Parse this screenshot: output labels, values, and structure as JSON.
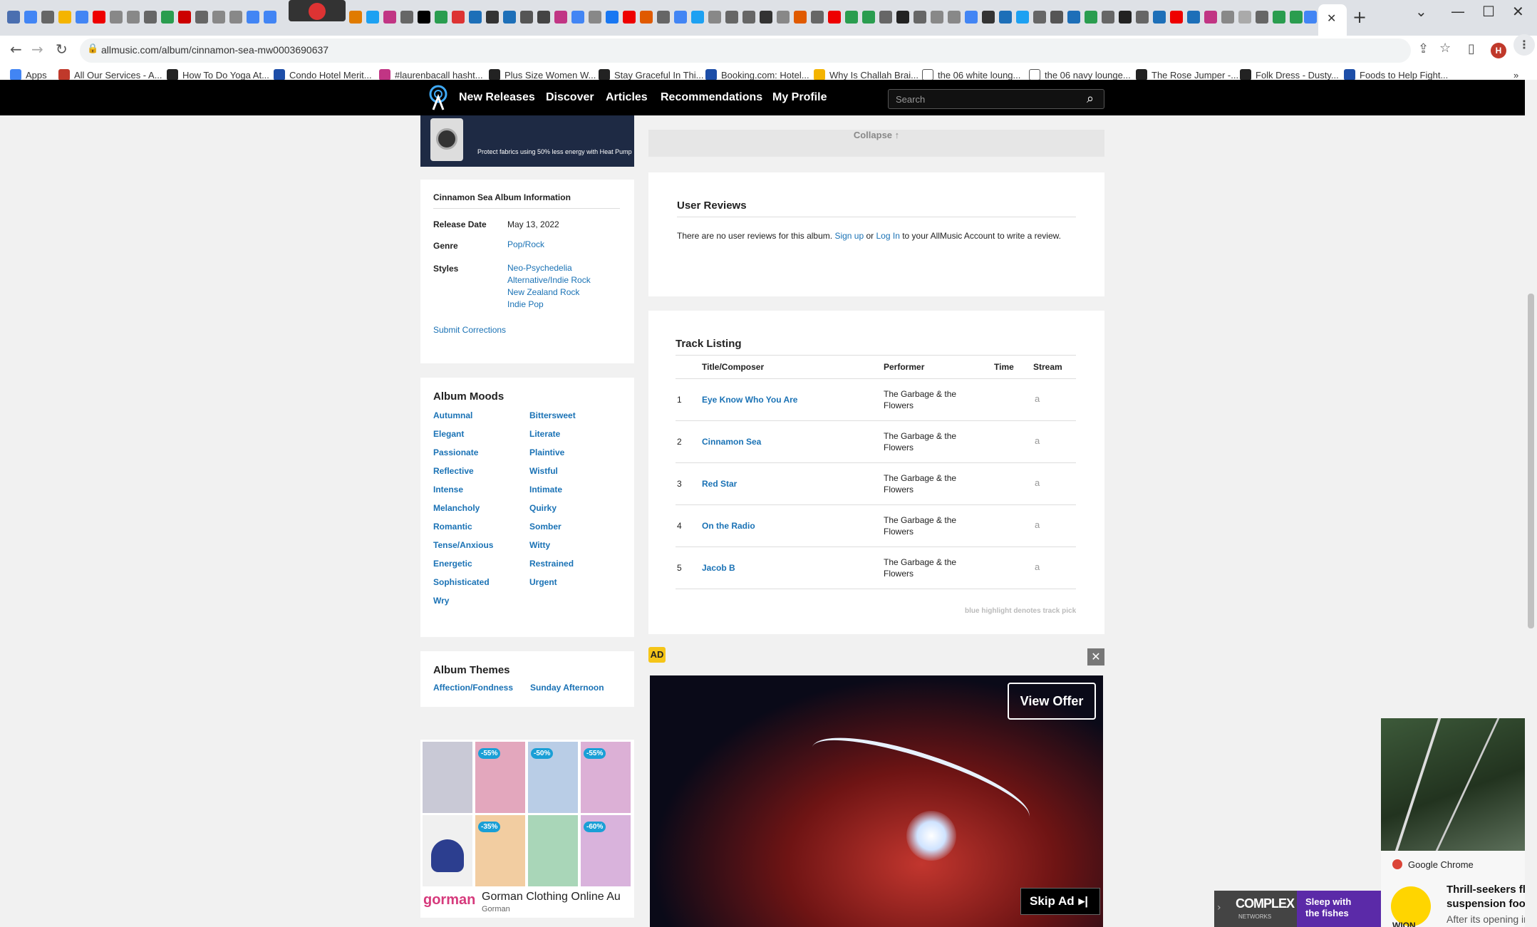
{
  "browser": {
    "url": "allmusic.com/album/cinnamon-sea-mw0003690637",
    "avatar_letter": "H",
    "bookmarks": [
      "Apps",
      "All Our Services - A...",
      "How To Do Yoga At...",
      "Condo Hotel Merit...",
      "#laurenbacall hasht...",
      "Plus Size Women W...",
      "Stay Graceful In Thi...",
      "Booking.com: Hotel...",
      "Why Is Challah Brai...",
      "the 06 white loung...",
      "the 06 navy lounge...",
      "The Rose Jumper -...",
      "Folk Dress - Dusty...",
      "Foods to Help Fight..."
    ]
  },
  "nav": {
    "links": [
      "New Releases",
      "Discover",
      "Articles",
      "Recommendations",
      "My Profile"
    ],
    "search_placeholder": "Search"
  },
  "top_ad": {
    "text": "Protect fabrics using 50% less energy with Heat Pump"
  },
  "collapse_label": "Collapse ↑",
  "album_info": {
    "heading": "Cinnamon Sea Album Information",
    "release_label": "Release Date",
    "release_value": "May 13, 2022",
    "genre_label": "Genre",
    "genre_value": "Pop/Rock",
    "styles_label": "Styles",
    "styles": [
      "Neo-Psychedelia",
      "Alternative/Indie Rock",
      "New Zealand Rock",
      "Indie Pop"
    ],
    "submit": "Submit Corrections"
  },
  "moods": {
    "heading": "Album Moods",
    "items": [
      "Autumnal",
      "Bittersweet",
      "Elegant",
      "Literate",
      "Passionate",
      "Plaintive",
      "Reflective",
      "Wistful",
      "Intense",
      "Intimate",
      "Melancholy",
      "Quirky",
      "Romantic",
      "Somber",
      "Tense/Anxious",
      "Witty",
      "Energetic",
      "Restrained",
      "Sophisticated",
      "Urgent",
      "Wry"
    ]
  },
  "themes": {
    "heading": "Album Themes",
    "items": [
      "Affection/Fondness",
      "Sunday Afternoon"
    ]
  },
  "user_reviews": {
    "heading": "User Reviews",
    "text_before": "There are no user reviews for this album.",
    "signup": "Sign up",
    "or": "or",
    "login": "Log In",
    "text_after": "to your AllMusic Account to write a review."
  },
  "tracks": {
    "heading": "Track Listing",
    "columns": [
      "Title/Composer",
      "Performer",
      "Time",
      "Stream"
    ],
    "rows": [
      {
        "num": "1",
        "title": "Eye Know Who You Are",
        "performer_1": "The Garbage & the",
        "performer_2": "Flowers"
      },
      {
        "num": "2",
        "title": "Cinnamon Sea",
        "performer_1": "The Garbage & the",
        "performer_2": "Flowers"
      },
      {
        "num": "3",
        "title": "Red Star",
        "performer_1": "The Garbage & the",
        "performer_2": "Flowers"
      },
      {
        "num": "4",
        "title": "On the Radio",
        "performer_1": "The Garbage & the",
        "performer_2": "Flowers"
      },
      {
        "num": "5",
        "title": "Jacob B",
        "performer_1": "The Garbage & the",
        "performer_2": "Flowers"
      }
    ],
    "stream_glyph": "a",
    "note": "blue highlight denotes track pick"
  },
  "video_ad": {
    "badge": "AD",
    "view_offer": "View Offer",
    "skip": "Skip Ad",
    "close": "✕"
  },
  "gorman_ad": {
    "logo": "gorman",
    "title": "Gorman Clothing Online Au",
    "sub": "Gorman",
    "badges": [
      "-55%",
      "-50%",
      "-55%",
      "-35%",
      "-60%"
    ]
  },
  "complex_ad": {
    "logo": "COMPLEX",
    "logo_sub": "NETWORKS",
    "text_1": "Sleep with",
    "text_2": "the fishes"
  },
  "notification": {
    "app": "Google Chrome",
    "source": "WION",
    "title_1": "Thrill-seekers flock",
    "title_2": "suspension footbri",
    "body": "After its opening in"
  },
  "colors": {
    "link": "#1a72b5",
    "navbar": "#000000",
    "ad_badge": "#f5c518"
  }
}
